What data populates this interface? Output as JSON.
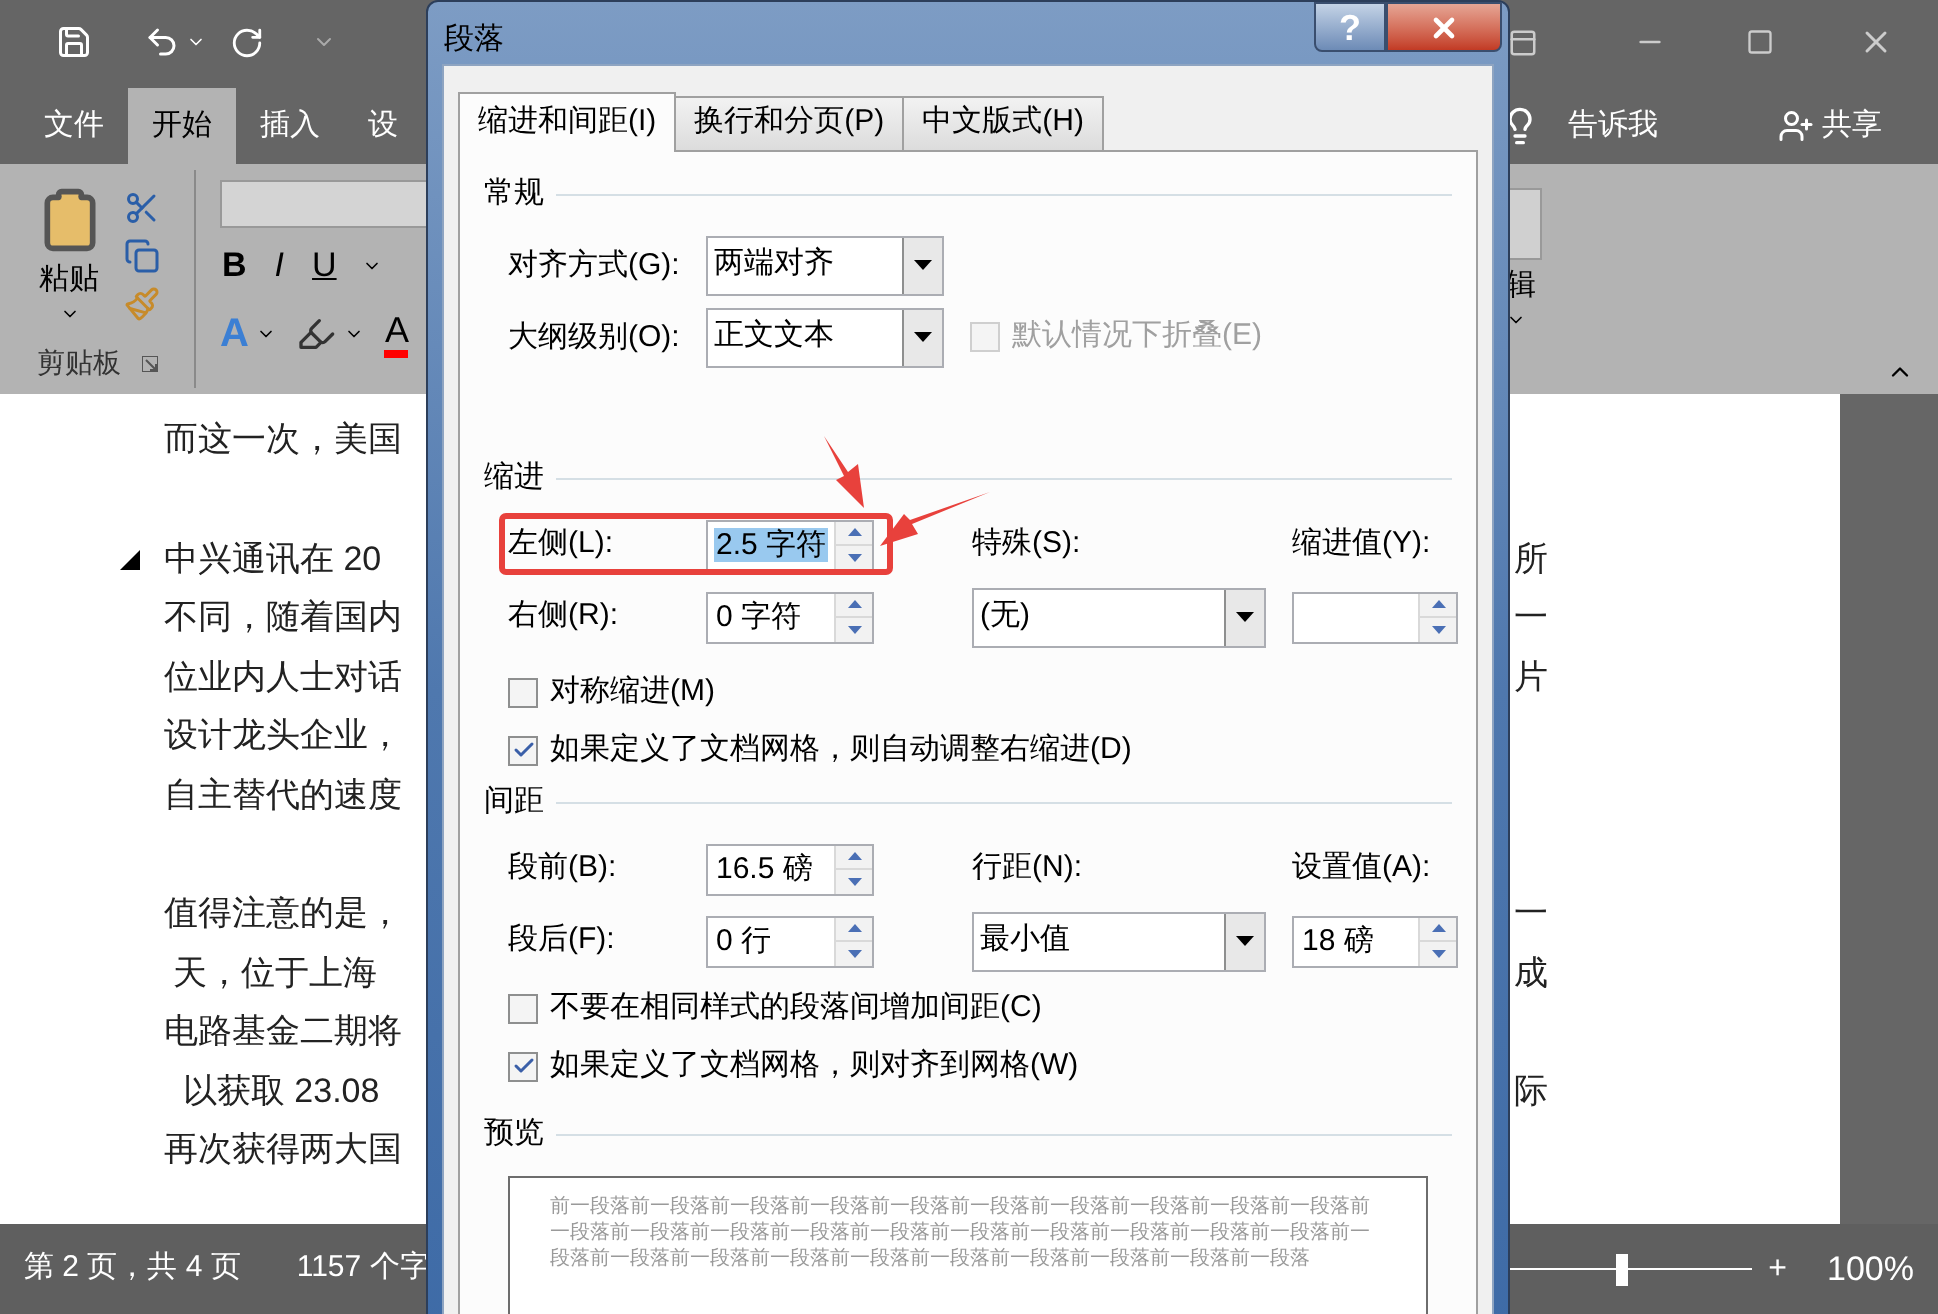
{
  "ribbon": {
    "tabs": [
      {
        "label": "文件",
        "selected": false
      },
      {
        "label": "开始",
        "selected": true
      },
      {
        "label": "插入",
        "selected": false
      },
      {
        "label": "设",
        "selected": false
      }
    ],
    "tell_me": "告诉我",
    "share": "共享",
    "clipboard": {
      "paste": "粘贴",
      "group": "剪贴板"
    },
    "font_buttons": [
      {
        "kind": "bold",
        "label": "B"
      },
      {
        "kind": "italic",
        "label": "I"
      },
      {
        "kind": "underline",
        "label": "U"
      }
    ],
    "effect_buttons": [
      {
        "kind": "text-effect",
        "label": "A"
      },
      {
        "kind": "highlight"
      },
      {
        "kind": "font-color",
        "label": "A"
      }
    ],
    "editing_group": "辑"
  },
  "document": {
    "paragraphs": [
      {
        "collapsible": false,
        "lines": [
          {
            "left": "而这一次，美国"
          }
        ]
      },
      {
        "collapsible": true,
        "lines": [
          {
            "left": "中兴通讯在 20",
            "right": "所"
          },
          {
            "left": "不同，随着国内",
            "right": "一"
          },
          {
            "left": "位业内人士对话",
            "right": "片"
          },
          {
            "left": "设计龙头企业，"
          },
          {
            "left": "自主替代的速度"
          }
        ]
      },
      {
        "collapsible": false,
        "lines": [
          {
            "left": "值得注意的是，",
            "right": "一"
          },
          {
            "left": " 天，位于上海",
            "right": "成"
          },
          {
            "left": "电路基金二期将"
          },
          {
            "left": "  以获取 23.08",
            "right": "际"
          },
          {
            "left": "再次获得两大国"
          }
        ]
      }
    ]
  },
  "status_bar": {
    "page": "第 2 页，共 4 页",
    "words": "1157 个字",
    "zoom_slider": {
      "level": 0.5
    },
    "zoom_in": "+",
    "zoom": "100%"
  },
  "dialog": {
    "title": "段落",
    "help": "?",
    "tabs": [
      {
        "label": "缩进和间距(I)",
        "selected": true
      },
      {
        "label": "换行和分页(P)",
        "selected": false
      },
      {
        "label": "中文版式(H)",
        "selected": false
      }
    ],
    "general": {
      "heading": "常规",
      "alignment": {
        "label": "对齐方式(G):",
        "value": "两端对齐"
      },
      "outline": {
        "label": "大纲级别(O):",
        "value": "正文文本"
      },
      "collapse": {
        "label": "默认情况下折叠(E)",
        "checked": false,
        "disabled": true
      }
    },
    "indent": {
      "heading": "缩进",
      "left": {
        "label": "左侧(L):",
        "value": "2.5 字符",
        "text_selected": true
      },
      "right": {
        "label": "右侧(R):",
        "value": "0 字符",
        "text_selected": false
      },
      "special": {
        "label": "特殊(S):",
        "value": "(无)"
      },
      "by": {
        "label": "缩进值(Y):"
      },
      "checks": [
        {
          "label": "对称缩进(M)",
          "checked": false
        },
        {
          "label": "如果定义了文档网格，则自动调整右缩进(D)",
          "checked": true
        }
      ]
    },
    "spacing": {
      "heading": "间距",
      "before": {
        "label": "段前(B):",
        "value": "16.5 磅"
      },
      "after": {
        "label": "段后(F):",
        "value": "0 行"
      },
      "line": {
        "label": "行距(N):",
        "value": "最小值"
      },
      "at": {
        "label": "设置值(A):",
        "value": "18 磅"
      },
      "checks": [
        {
          "label": "不要在相同样式的段落间增加间距(C)",
          "checked": false
        },
        {
          "label": "如果定义了文档网格，则对齐到网格(W)",
          "checked": true
        }
      ]
    },
    "preview": {
      "heading": "预览",
      "text": "前一段落前一段落前一段落前一段落前一段落前一段落前一段落前一段落前一段落前一段落前一段落前一段落前一段落前一段落前一段落前一段落前一段落前一段落前一段落前一段落前一段落前一段落前一段落前一段落前一段落前一段落前一段落前一段落前一段落前一段落"
    }
  }
}
